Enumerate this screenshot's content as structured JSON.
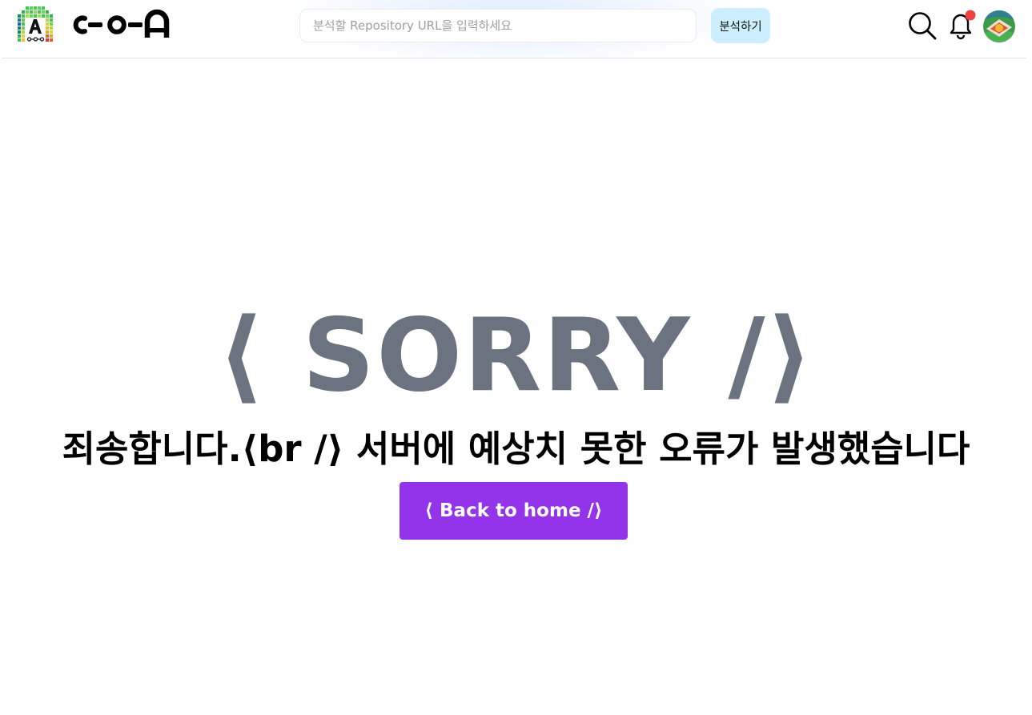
{
  "header": {
    "logo_name": "C-O-A",
    "search": {
      "placeholder": "분석할 Repository URL을 입력하세요",
      "value": ""
    },
    "analyze_label": "분석하기",
    "icons": [
      "logo-icon",
      "search-icon",
      "bell-icon",
      "avatar"
    ],
    "notification_dot_color": "#ef4444"
  },
  "main": {
    "heading": "⟨ SORRY /⟩",
    "message": "죄송합니다.⟨br /⟩ 서버에 예상치 못한 오류가 발생했습니다",
    "home_button_label": "⟨ Back to home /⟩"
  },
  "colors": {
    "heading": "#6b7280",
    "button": "#9333ea",
    "analyze_button_bg": "#cdeefc"
  }
}
